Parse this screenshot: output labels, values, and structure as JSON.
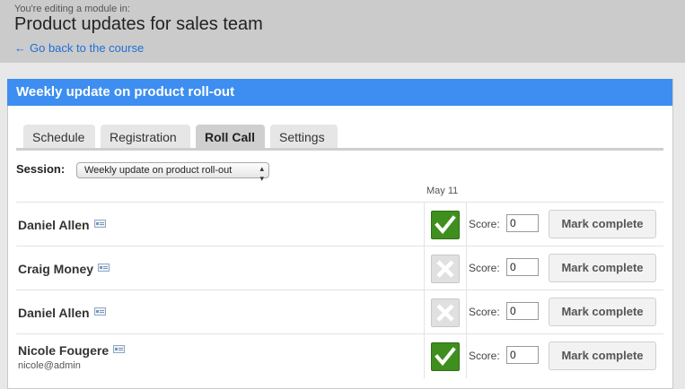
{
  "header": {
    "editing_note": "You're editing a module in:",
    "title": "Product updates for sales team",
    "back_link": "Go back to the course",
    "back_arrow": "←"
  },
  "panel": {
    "title": "Weekly update on product roll-out"
  },
  "tabs": [
    {
      "label": "Schedule",
      "active": false
    },
    {
      "label": "Registration",
      "active": false
    },
    {
      "label": "Roll Call",
      "active": true
    },
    {
      "label": "Settings",
      "active": false
    }
  ],
  "session": {
    "label": "Session:",
    "selected": "Weekly update on product roll-out"
  },
  "date_column": "May 11",
  "score_label": "Score:",
  "mark_label": "Mark complete",
  "attendees": [
    {
      "name": "Daniel Allen",
      "email": "",
      "present": true,
      "score": "0"
    },
    {
      "name": "Craig Money",
      "email": "",
      "present": false,
      "score": "0"
    },
    {
      "name": "Daniel Allen",
      "email": "",
      "present": false,
      "score": "0"
    },
    {
      "name": "Nicole Fougere",
      "email": "nicole@admin",
      "present": true,
      "score": "0"
    }
  ],
  "colors": {
    "accent": "#3d8ef0",
    "present": "#3f8f1f",
    "link": "#1f6fd6"
  }
}
